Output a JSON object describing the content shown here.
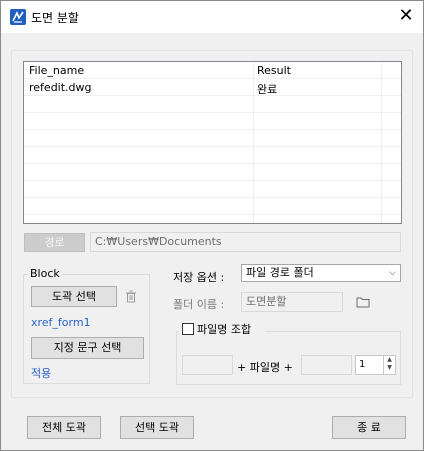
{
  "window": {
    "title": "도면 분할",
    "close_glyph": "✕"
  },
  "list": {
    "headers": [
      "File_name",
      "Result"
    ],
    "rows": [
      [
        "refedit.dwg",
        "완료"
      ]
    ]
  },
  "path": {
    "button_label": "경로",
    "value": "C:₩Users₩Documents"
  },
  "block": {
    "group_label": "Block",
    "select_drawing_label": "도곽 선택",
    "selected_block": "xref_form1",
    "select_text_label": "지정 문구 선택",
    "apply_link": "적용"
  },
  "save": {
    "option_label": "저장 옵션 :",
    "option_value": "파일 경로 폴더",
    "folder_name_label": "폴더 이름 :",
    "folder_name_value": "도면분할"
  },
  "combine": {
    "checkbox_label": "파일명 조합",
    "checked": false,
    "plus_filename": "+ 파일명 +",
    "spin_value": "1"
  },
  "footer": {
    "all_drawings": "전체 도곽",
    "selected_drawings": "선택 도곽",
    "exit": "종 료"
  },
  "colors": {
    "link": "#2b63c9",
    "app_icon": "#1f5fbf"
  }
}
